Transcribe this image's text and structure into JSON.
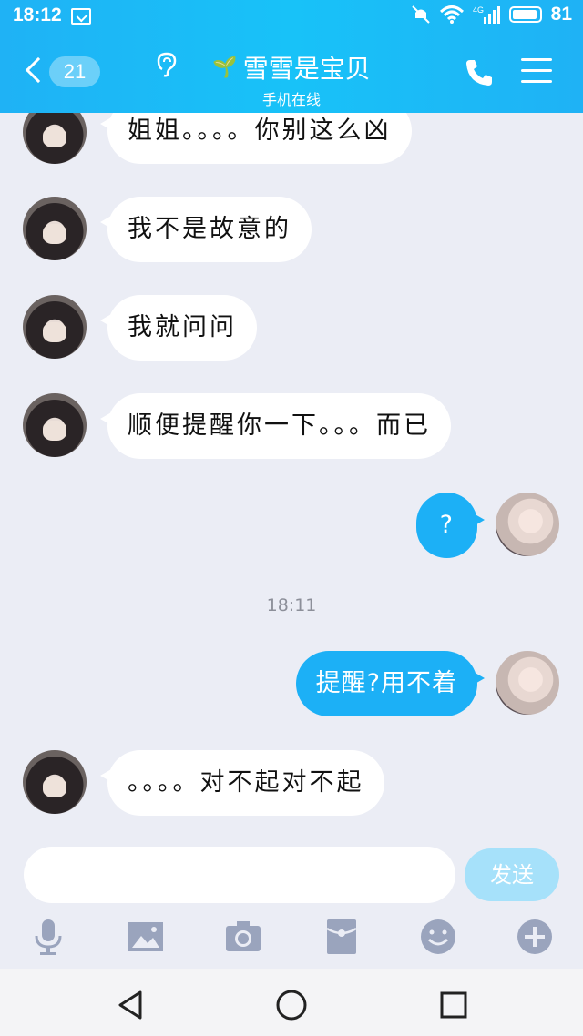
{
  "status_bar": {
    "time": "18:12",
    "battery": "81",
    "network": "4G"
  },
  "header": {
    "back_count": "21",
    "title": "雪雪是宝贝",
    "subtitle": "手机在线",
    "icons": {
      "back": "back-chevron-icon",
      "ear": "ear-icon",
      "sprout": "sprout-icon",
      "phone": "phone-icon",
      "menu": "menu-icon"
    }
  },
  "messages": [
    {
      "side": "in",
      "text": "姐姐。。。。你别这么凶"
    },
    {
      "side": "in",
      "text": "我不是故意的"
    },
    {
      "side": "in",
      "text": "我就问问"
    },
    {
      "side": "in",
      "text": "顺便提醒你一下。。。而已"
    },
    {
      "side": "out",
      "text": "?"
    },
    {
      "timestamp": "18:11"
    },
    {
      "side": "out",
      "text": "提醒?用不着"
    },
    {
      "side": "in",
      "text": "。。。。对不起对不起"
    }
  ],
  "input": {
    "placeholder": "",
    "send_label": "发送"
  },
  "toolbar": [
    "microphone-icon",
    "image-icon",
    "camera-icon",
    "red-packet-icon",
    "emoji-icon",
    "plus-icon"
  ],
  "colors": {
    "header": "#18c2f8",
    "out_bubble": "#1cb0f6",
    "in_bubble": "#ffffff",
    "background": "#ebedf5",
    "send_disabled": "#a6e1fa",
    "toolbar_icon": "#9aa4bd"
  }
}
